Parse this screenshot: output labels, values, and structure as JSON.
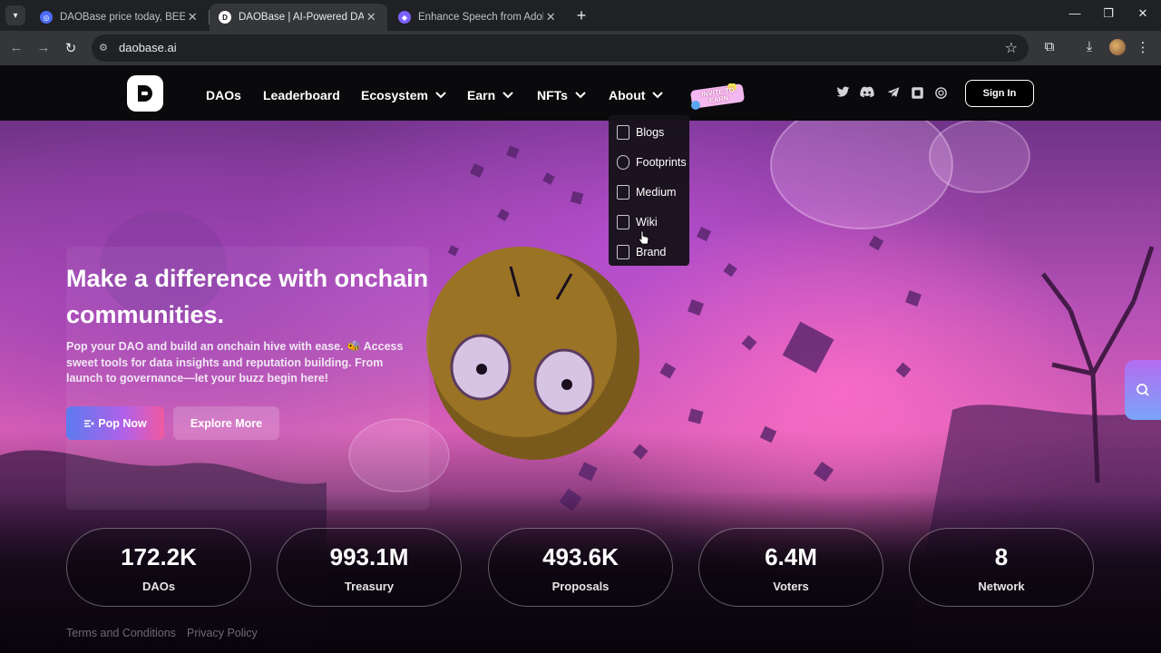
{
  "browser": {
    "tabs": [
      {
        "title": "DAOBase price today, BEE to US",
        "active": false,
        "favicon_color": "#4a6cf7"
      },
      {
        "title": "DAOBase | AI-Powered DAO La",
        "active": true,
        "favicon_color": "#ffffff"
      },
      {
        "title": "Enhance Speech from Adobe | F",
        "active": false,
        "favicon_color": "#7b61ff"
      }
    ],
    "url": "daobase.ai"
  },
  "navbar": {
    "links": [
      {
        "label": "DAOs",
        "dropdown": false
      },
      {
        "label": "Leaderboard",
        "dropdown": false
      },
      {
        "label": "Ecosystem",
        "dropdown": true
      },
      {
        "label": "Earn",
        "dropdown": true
      },
      {
        "label": "NFTs",
        "dropdown": true
      },
      {
        "label": "About",
        "dropdown": true
      }
    ],
    "invite_badge": "INVITE TO EARN",
    "social_icons": [
      "twitter-icon",
      "discord-icon",
      "telegram-icon",
      "gitbook-icon",
      "openai-icon"
    ],
    "signin_label": "Sign In"
  },
  "about_menu": {
    "items": [
      {
        "label": "Blogs"
      },
      {
        "label": "Footprints"
      },
      {
        "label": "Medium"
      },
      {
        "label": "Wiki"
      },
      {
        "label": "Brand"
      }
    ]
  },
  "hero": {
    "title": "Make a difference with onchain communities.",
    "subtitle": "Pop your DAO and build an onchain hive with ease. 🐝 Access sweet tools for data insights and reputation building. From launch to governance—let your buzz begin here!",
    "primary_button": "Pop Now",
    "secondary_button": "Explore More"
  },
  "stats": [
    {
      "value": "172.2K",
      "label": "DAOs"
    },
    {
      "value": "993.1M",
      "label": "Treasury"
    },
    {
      "value": "493.6K",
      "label": "Proposals"
    },
    {
      "value": "6.4M",
      "label": "Voters"
    },
    {
      "value": "8",
      "label": "Network"
    }
  ],
  "footer": {
    "terms": "Terms and Conditions",
    "privacy": "Privacy Policy"
  },
  "colors": {
    "accent_gradient_start": "#5b7cf0",
    "accent_gradient_end": "#f05aa0",
    "nav_bg": "#0a0a0c"
  }
}
